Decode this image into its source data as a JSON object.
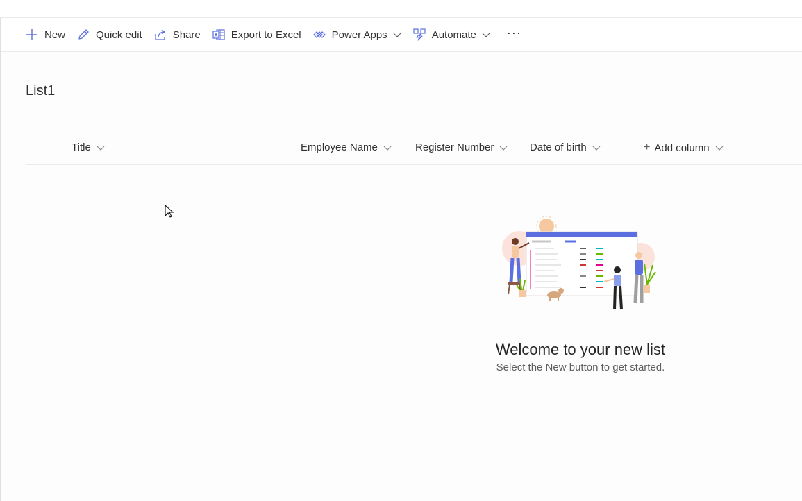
{
  "commandbar": {
    "new_label": "New",
    "quick_edit_label": "Quick edit",
    "share_label": "Share",
    "export_label": "Export to Excel",
    "power_apps_label": "Power Apps",
    "automate_label": "Automate",
    "more_label": "···"
  },
  "list": {
    "title": "List1",
    "columns": [
      "Title",
      "Employee Name",
      "Register Number",
      "Date of birth"
    ],
    "add_column_label": "Add column"
  },
  "empty_state": {
    "heading": "Welcome to your new list",
    "subtext": "Select the New button to get started."
  },
  "colors": {
    "accent": "#5b6fe0",
    "text": "#323130",
    "subtext": "#605e5c",
    "divider": "#edebe9"
  }
}
